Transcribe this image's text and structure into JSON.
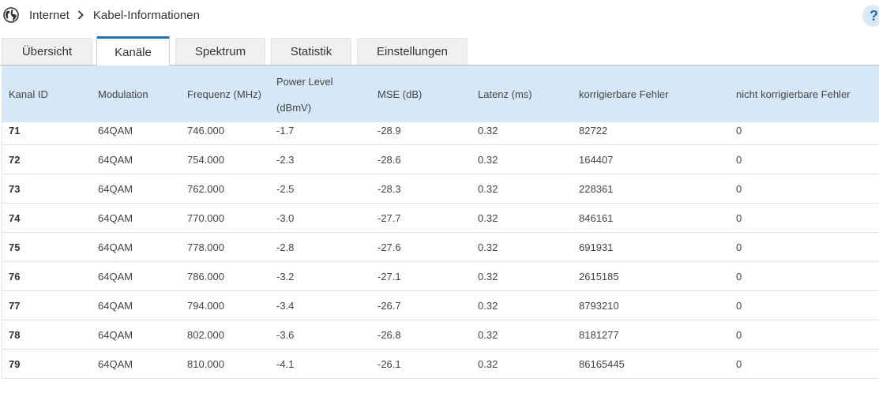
{
  "breadcrumb": {
    "icon": "globe-icon",
    "items": [
      "Internet",
      "Kabel-Informationen"
    ]
  },
  "help": {
    "label": "?"
  },
  "tabs": [
    {
      "label": "Übersicht",
      "active": false
    },
    {
      "label": "Kanäle",
      "active": true
    },
    {
      "label": "Spektrum",
      "active": false
    },
    {
      "label": "Statistik",
      "active": false
    },
    {
      "label": "Einstellungen",
      "active": false
    }
  ],
  "table": {
    "headers": {
      "kanal_id": "Kanal ID",
      "modulation": "Modulation",
      "frequenz": "Frequenz (MHz)",
      "power_line1": "Power Level",
      "power_line2": "(dBmV)",
      "mse": "MSE (dB)",
      "latenz": "Latenz (ms)",
      "korr": "korrigierbare Fehler",
      "nicht_korr": "nicht korrigierbare Fehler"
    },
    "rows": [
      {
        "id": "71",
        "mod": "64QAM",
        "freq": "746.000",
        "power": "-1.7",
        "mse": "-28.9",
        "lat": "0.32",
        "korr": "82722",
        "nkorr": "0"
      },
      {
        "id": "72",
        "mod": "64QAM",
        "freq": "754.000",
        "power": "-2.3",
        "mse": "-28.6",
        "lat": "0.32",
        "korr": "164407",
        "nkorr": "0"
      },
      {
        "id": "73",
        "mod": "64QAM",
        "freq": "762.000",
        "power": "-2.5",
        "mse": "-28.3",
        "lat": "0.32",
        "korr": "228361",
        "nkorr": "0"
      },
      {
        "id": "74",
        "mod": "64QAM",
        "freq": "770.000",
        "power": "-3.0",
        "mse": "-27.7",
        "lat": "0.32",
        "korr": "846161",
        "nkorr": "0"
      },
      {
        "id": "75",
        "mod": "64QAM",
        "freq": "778.000",
        "power": "-2.8",
        "mse": "-27.6",
        "lat": "0.32",
        "korr": "691931",
        "nkorr": "0"
      },
      {
        "id": "76",
        "mod": "64QAM",
        "freq": "786.000",
        "power": "-3.2",
        "mse": "-27.1",
        "lat": "0.32",
        "korr": "2615185",
        "nkorr": "0"
      },
      {
        "id": "77",
        "mod": "64QAM",
        "freq": "794.000",
        "power": "-3.4",
        "mse": "-26.7",
        "lat": "0.32",
        "korr": "8793210",
        "nkorr": "0"
      },
      {
        "id": "78",
        "mod": "64QAM",
        "freq": "802.000",
        "power": "-3.6",
        "mse": "-26.8",
        "lat": "0.32",
        "korr": "8181277",
        "nkorr": "0"
      },
      {
        "id": "79",
        "mod": "64QAM",
        "freq": "810.000",
        "power": "-4.1",
        "mse": "-26.1",
        "lat": "0.32",
        "korr": "86165445",
        "nkorr": "0"
      }
    ]
  },
  "colors": {
    "accent": "#1f6fb5",
    "header_bg": "#d6e8f7",
    "tab_bg": "#f0f0f0"
  }
}
